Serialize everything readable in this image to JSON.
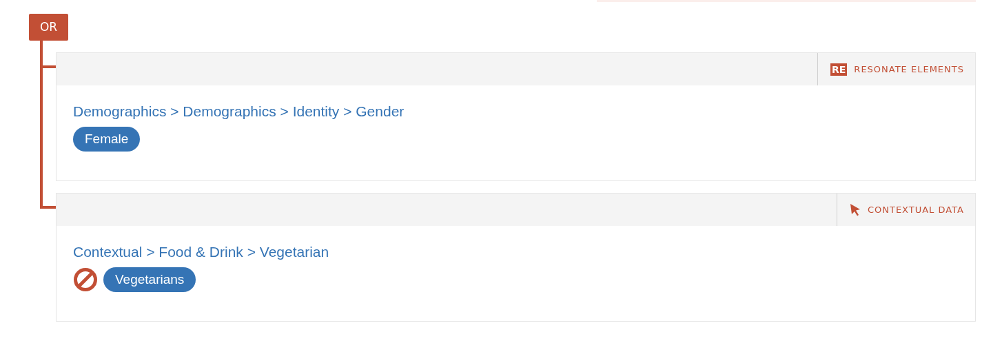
{
  "operator": "OR",
  "conditions": [
    {
      "source": {
        "kind": "resonate",
        "logo": "RE",
        "label": "RESONATE ELEMENTS"
      },
      "path": "Demographics > Demographics > Identity > Gender",
      "tags": [
        {
          "label": "Female",
          "excluded": false
        }
      ]
    },
    {
      "source": {
        "kind": "contextual",
        "label": "CONTEXTUAL DATA"
      },
      "path": "Contextual > Food & Drink > Vegetarian",
      "tags": [
        {
          "label": "Vegetarians",
          "excluded": true
        }
      ]
    }
  ]
}
